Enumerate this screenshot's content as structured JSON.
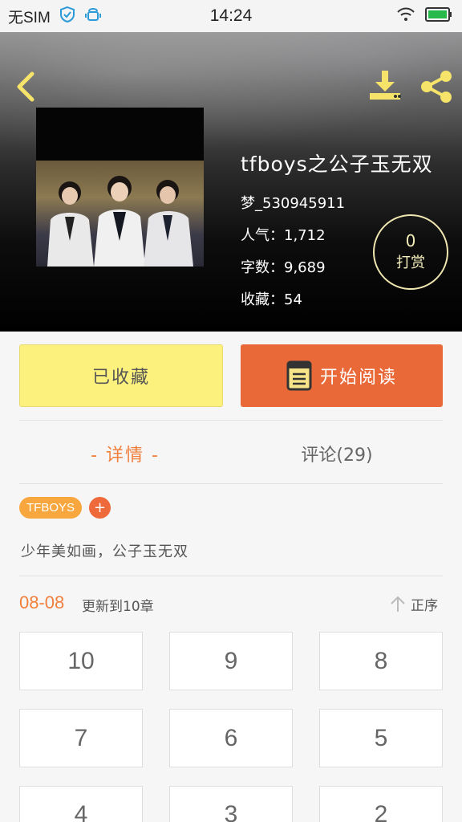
{
  "status_bar": {
    "sim": "无SIM",
    "time": "14:24"
  },
  "book": {
    "title": "tfboys之公子玉无双",
    "author": "梦_530945911",
    "popularity": "人气：1,712",
    "word_count": "字数：9,689",
    "favorites": "收藏：54"
  },
  "tip": {
    "count": "0",
    "label": "打赏"
  },
  "actions": {
    "collected_label": "已收藏",
    "read_label": "开始阅读"
  },
  "tabs": {
    "detail": "- 详情 -",
    "comments": "评论(29)"
  },
  "tags": [
    "TFBOYS"
  ],
  "tag_add": "+",
  "synopsis": "少年美如画，公子玉无双",
  "update": {
    "date": "08-08",
    "text": "更新到10章",
    "sort_label": "正序"
  },
  "chapters": [
    "10",
    "9",
    "8",
    "7",
    "6",
    "5",
    "4",
    "3",
    "2"
  ],
  "colors": {
    "accent_orange": "#e96a38",
    "collected_yellow": "#fdf17e",
    "tag_orange": "#f8a73e",
    "icon_yellow": "#f6e36a"
  },
  "icons": {
    "back": "chevron-left-icon",
    "download": "download-icon",
    "share": "share-icon",
    "book": "book-icon",
    "sort": "arrow-up-icon"
  }
}
